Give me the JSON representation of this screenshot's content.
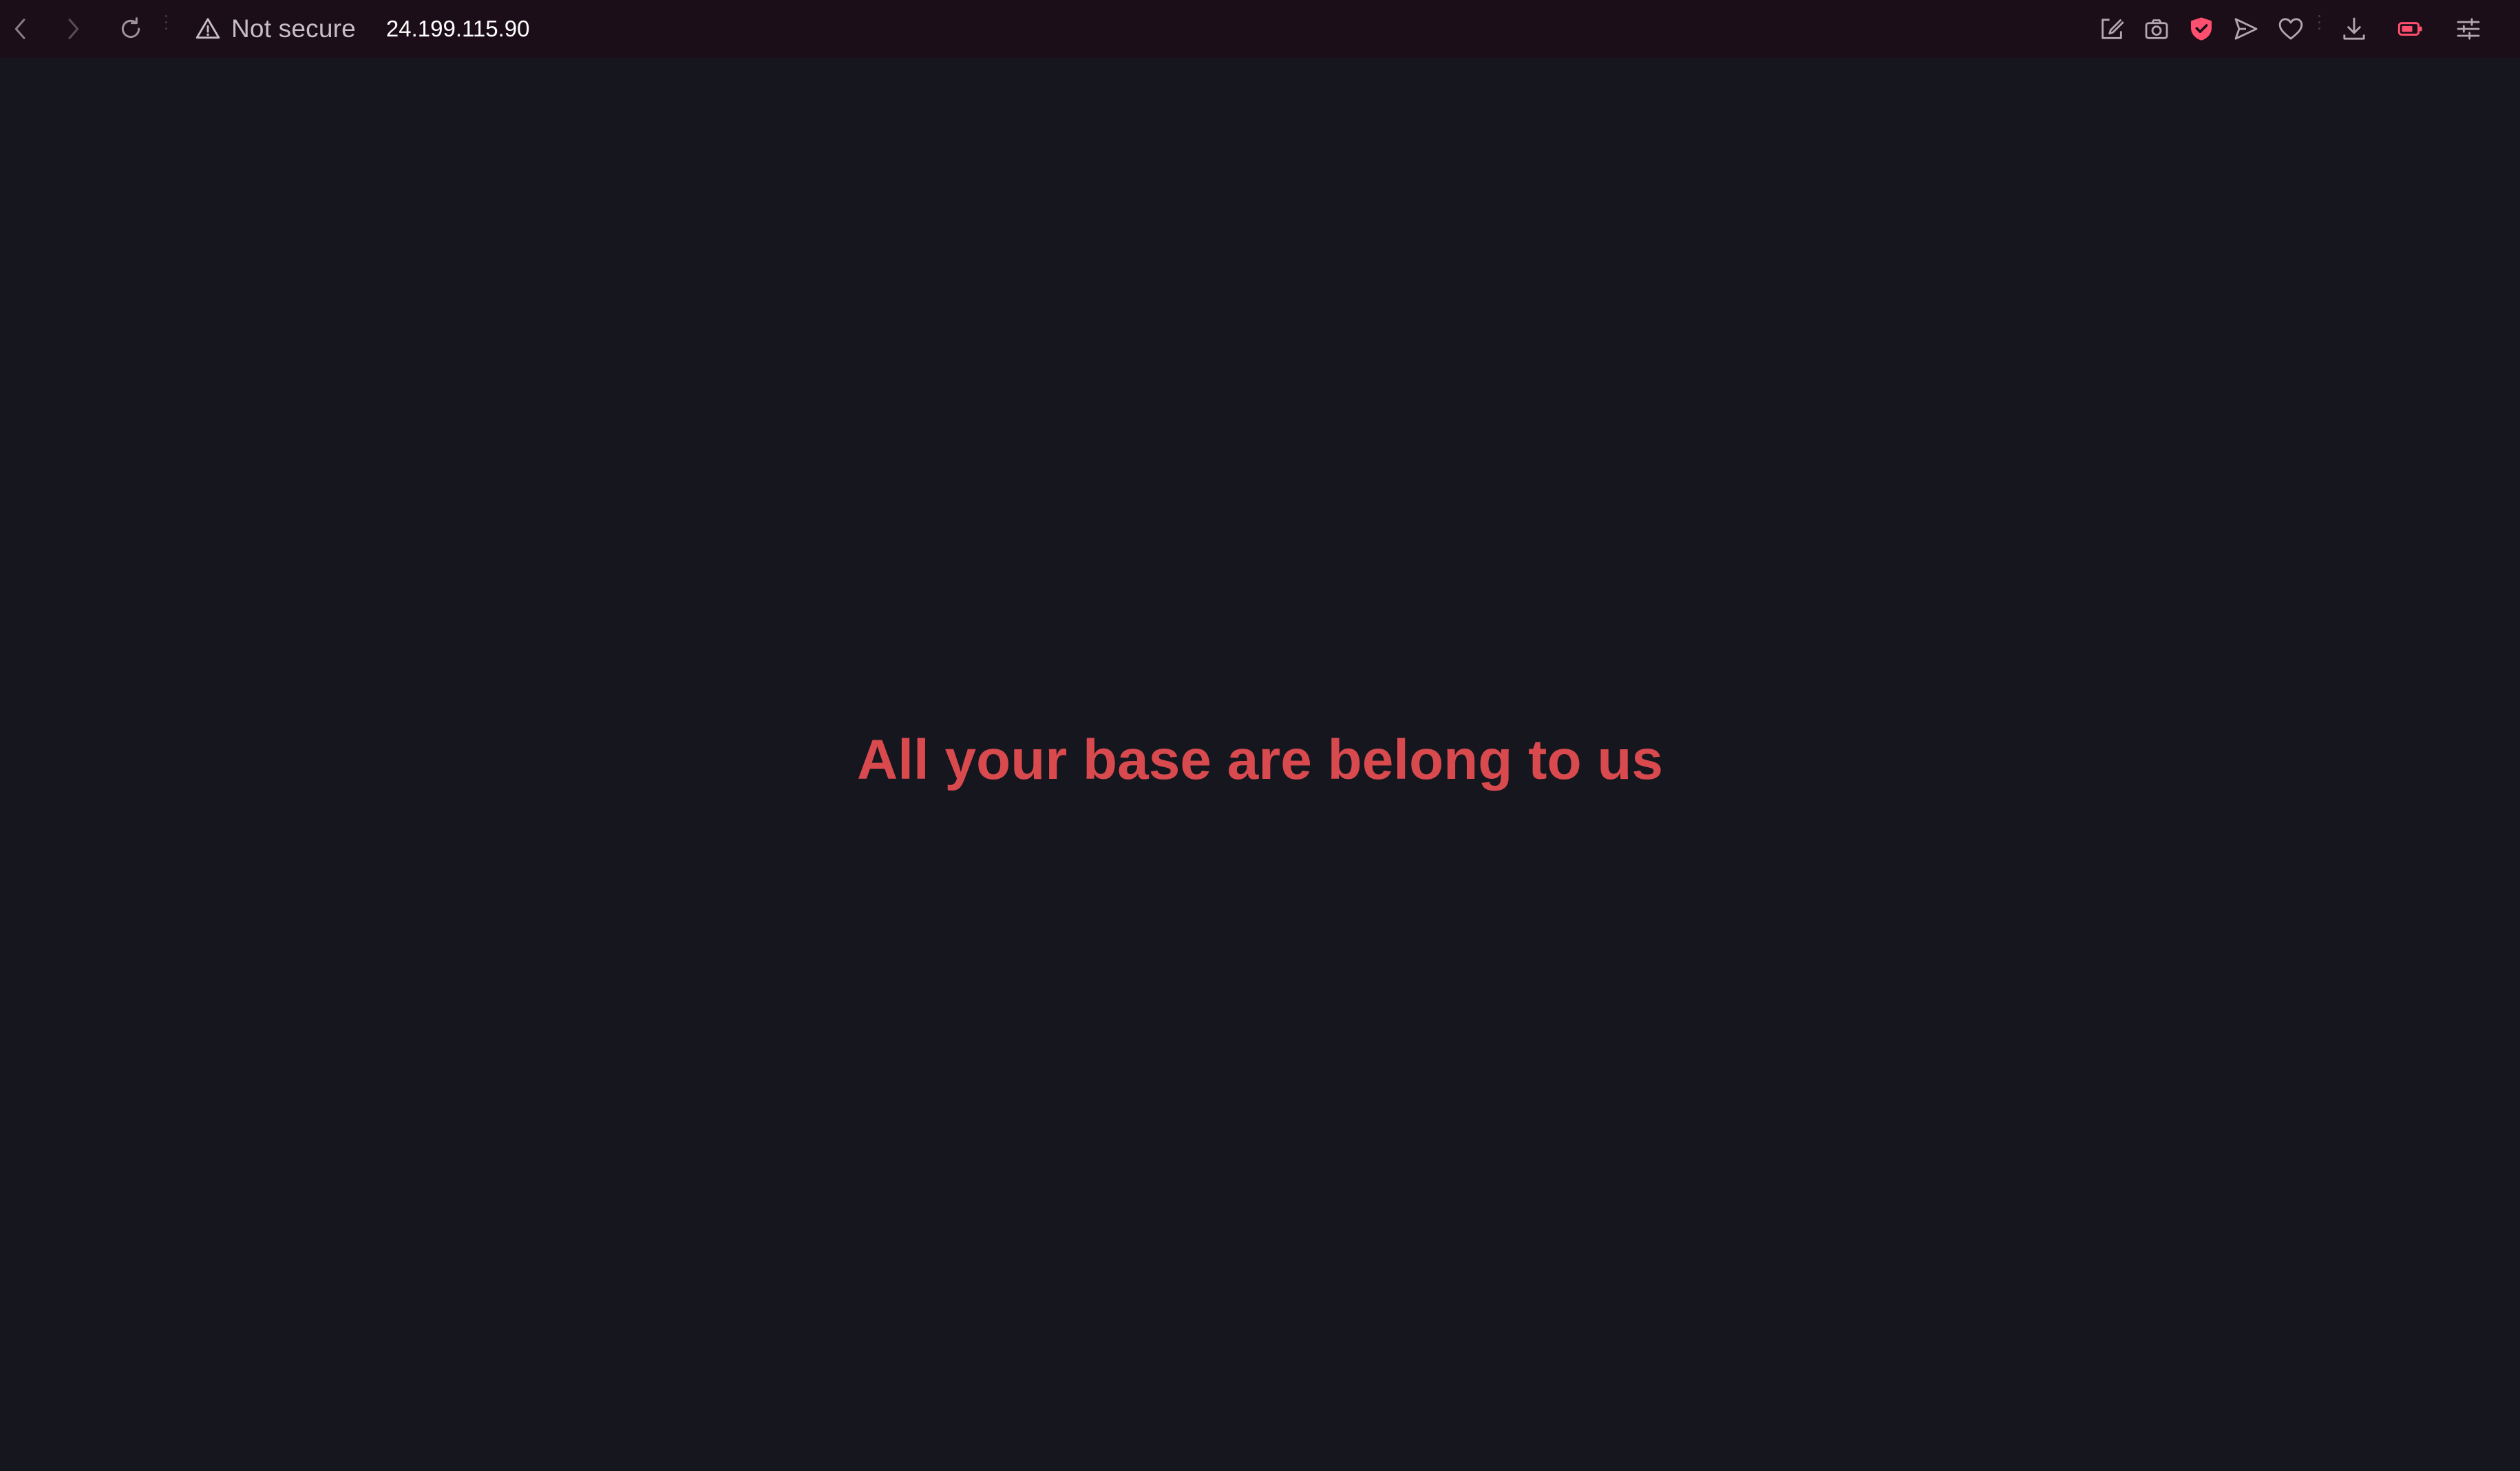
{
  "browser": {
    "security_label": "Not secure",
    "url": "24.199.115.90",
    "icons": {
      "back": "back-arrow-icon",
      "forward": "forward-arrow-icon",
      "reload": "reload-icon",
      "warning": "warning-triangle-icon",
      "share": "share-edit-icon",
      "snapshot": "camera-icon",
      "shield": "shield-icon",
      "send": "send-icon",
      "favorite": "heart-icon",
      "download": "download-icon",
      "battery": "battery-icon",
      "settings": "settings-sliders-icon"
    },
    "colors": {
      "toolbar_bg": "#1c0e18",
      "accent": "#ff4f6e",
      "page_bg": "#16161e"
    }
  },
  "page": {
    "headline": "All your base are belong to us",
    "headline_color": "#d94a4f"
  }
}
